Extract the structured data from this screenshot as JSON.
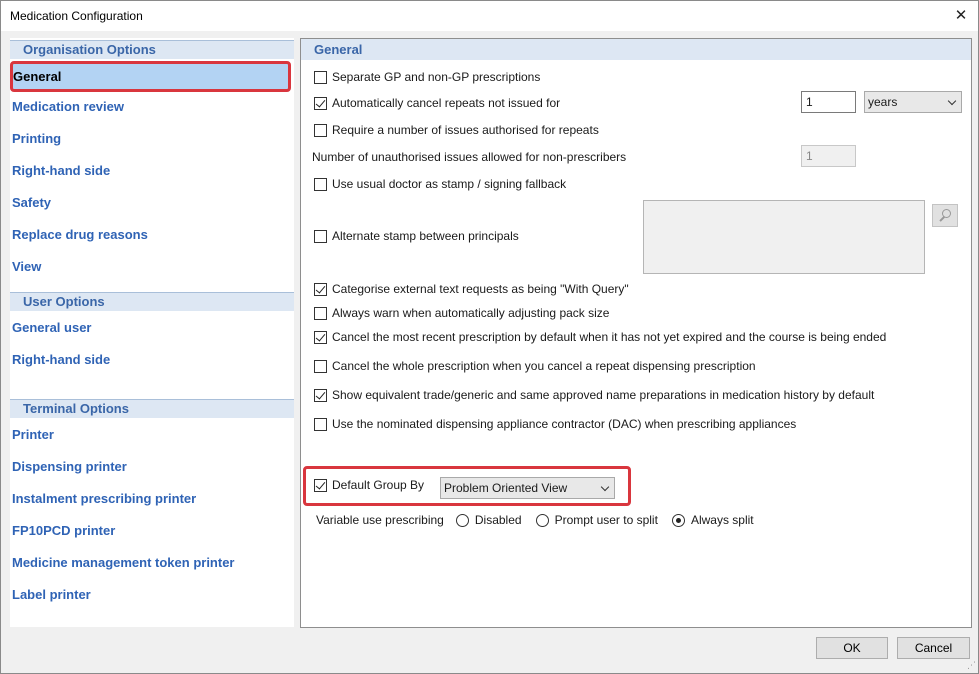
{
  "window": {
    "title": "Medication Configuration",
    "close_glyph": "✕"
  },
  "sidebar": {
    "organisation": {
      "header": "Organisation Options",
      "items": [
        "General",
        "Medication review",
        "Printing",
        "Right-hand side",
        "Safety",
        "Replace drug reasons",
        "View"
      ],
      "selected": "General"
    },
    "user": {
      "header": "User Options",
      "items": [
        "General user",
        "Right-hand side"
      ]
    },
    "terminal": {
      "header": "Terminal Options",
      "items": [
        "Printer",
        "Dispensing printer",
        "Instalment prescribing printer",
        "FP10PCD printer",
        "Medicine management token printer",
        "Label printer"
      ]
    }
  },
  "main": {
    "header": "General",
    "options": {
      "separate_gp": {
        "label": "Separate GP and non-GP prescriptions",
        "checked": false
      },
      "auto_cancel": {
        "label": "Automatically cancel repeats not issued for",
        "checked": true,
        "value": "1",
        "unit": "years"
      },
      "require_issues": {
        "label": "Require a number of issues authorised for repeats",
        "checked": false
      },
      "unauth_issues": {
        "label": "Number of unauthorised issues allowed for non-prescribers",
        "value": "1"
      },
      "usual_doctor": {
        "label": "Use usual doctor as stamp / signing fallback",
        "checked": false
      },
      "alternate_stamp": {
        "label": "Alternate stamp between principals",
        "checked": false
      },
      "categorise": {
        "label": "Categorise external text requests as being \"With Query\"",
        "checked": true
      },
      "always_warn": {
        "label": "Always warn when automatically adjusting pack size",
        "checked": false
      },
      "cancel_recent": {
        "label": "Cancel the most recent prescription by default when it has not yet expired and the course is being ended",
        "checked": true
      },
      "cancel_whole": {
        "label": "Cancel the whole prescription when you cancel a repeat dispensing prescription",
        "checked": false
      },
      "show_equivalent": {
        "label": "Show equivalent trade/generic and same approved name preparations in medication history by default",
        "checked": true
      },
      "use_dac": {
        "label": "Use the nominated dispensing appliance contractor (DAC) when prescribing appliances",
        "checked": false
      },
      "default_group": {
        "label": "Default Group By",
        "checked": true,
        "value": "Problem Oriented View"
      }
    },
    "variable_use": {
      "label": "Variable use prescribing",
      "options": [
        "Disabled",
        "Prompt user to split",
        "Always split"
      ],
      "selected": "Always split"
    }
  },
  "footer": {
    "ok": "OK",
    "cancel": "Cancel"
  },
  "colors": {
    "accent": "#2f63b5",
    "highlight": "#d9363e",
    "selected_bg": "#b3d3f3",
    "header_bg": "#dde7f3"
  }
}
